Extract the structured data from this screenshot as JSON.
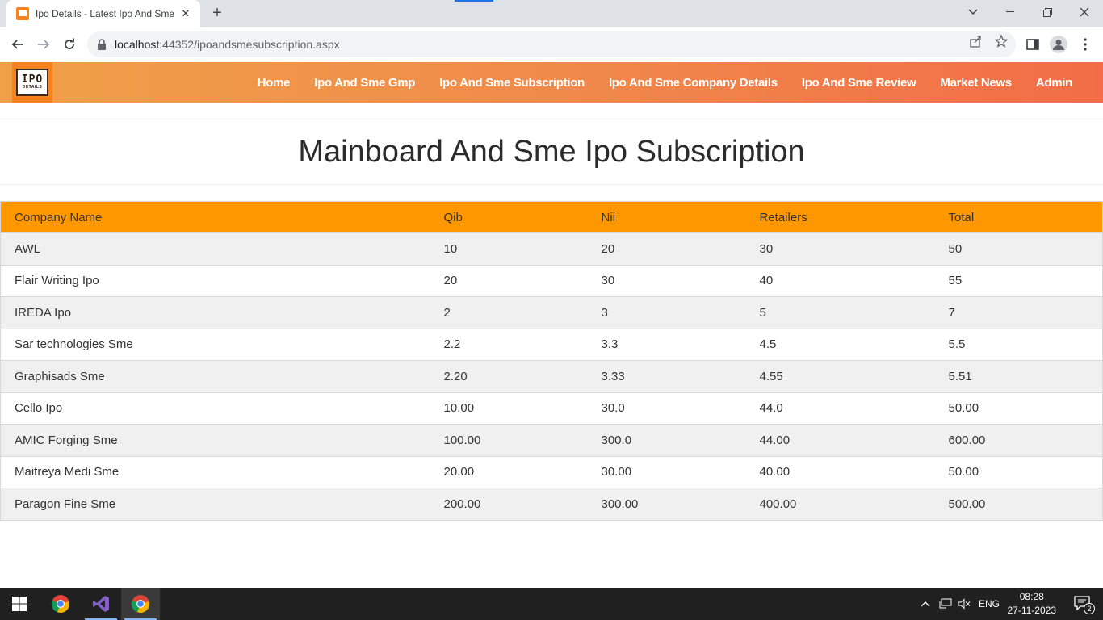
{
  "browser": {
    "tab_title": "Ipo Details - Latest Ipo And Sme",
    "url_host": "localhost",
    "url_rest": ":44352/ipoandsmesubscription.aspx"
  },
  "site": {
    "logo_top": "IPO",
    "logo_bottom": "DETAILS",
    "menu": [
      "Home",
      "Ipo And Sme Gmp",
      "Ipo And Sme Subscription",
      "Ipo And Sme Company Details",
      "Ipo And Sme Review",
      "Market News",
      "Admin"
    ]
  },
  "page": {
    "title": "Mainboard And Sme Ipo Subscription"
  },
  "table": {
    "headers": [
      "Company Name",
      "Qib",
      "Nii",
      "Retailers",
      "Total"
    ],
    "rows": [
      [
        "AWL",
        "10",
        "20",
        "30",
        "50"
      ],
      [
        "Flair Writing Ipo",
        "20",
        "30",
        "40",
        "55"
      ],
      [
        "IREDA Ipo",
        "2",
        "3",
        "5",
        "7"
      ],
      [
        "Sar technologies Sme",
        "2.2",
        "3.3",
        "4.5",
        "5.5"
      ],
      [
        "Graphisads Sme",
        "2.20",
        "3.33",
        "4.55",
        "5.51"
      ],
      [
        "Cello Ipo",
        "10.00",
        "30.0",
        "44.0",
        "50.00"
      ],
      [
        "AMIC Forging Sme",
        "100.00",
        "300.0",
        "44.00",
        "600.00"
      ],
      [
        "Maitreya Medi Sme",
        "20.00",
        "30.00",
        "40.00",
        "50.00"
      ],
      [
        "Paragon Fine Sme",
        "200.00",
        "300.00",
        "400.00",
        "500.00"
      ]
    ]
  },
  "taskbar": {
    "language": "ENG",
    "time": "08:28",
    "date": "27-11-2023",
    "notification_count": "2"
  },
  "colors": {
    "table_header": "#ff9700",
    "nav_gradient_start": "#f0a148",
    "nav_gradient_end": "#f26d47"
  }
}
